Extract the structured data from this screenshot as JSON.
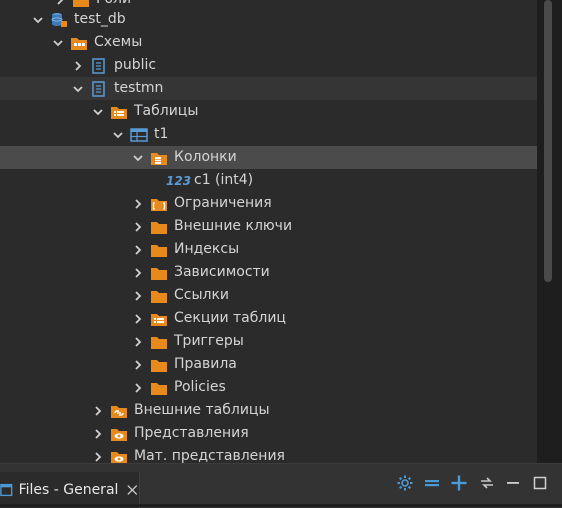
{
  "tree": {
    "items": [
      {
        "id": "roles",
        "label": "Роли",
        "twisty": "right",
        "icon": "folder-roles-icon"
      },
      {
        "id": "test_db",
        "label": "test_db",
        "twisty": "down",
        "icon": "database-icon"
      },
      {
        "id": "schemas",
        "label": "Схемы",
        "twisty": "down",
        "icon": "folder-schemas-icon"
      },
      {
        "id": "public",
        "label": "public",
        "twisty": "right",
        "icon": "schema-icon"
      },
      {
        "id": "testmn",
        "label": "testmn",
        "twisty": "down",
        "icon": "schema-icon"
      },
      {
        "id": "tables",
        "label": "Таблицы",
        "twisty": "down",
        "icon": "folder-tables-icon"
      },
      {
        "id": "t1",
        "label": "t1",
        "twisty": "down",
        "icon": "table-icon"
      },
      {
        "id": "columns",
        "label": "Колонки",
        "twisty": "down",
        "icon": "folder-columns-icon"
      },
      {
        "id": "c1",
        "label": "c1 (int4)",
        "twisty": "none",
        "icon": "numeric-column-icon",
        "icon_text": "123"
      },
      {
        "id": "constraints",
        "label": "Ограничения",
        "twisty": "right",
        "icon": "folder-constraints-icon"
      },
      {
        "id": "fk",
        "label": "Внешние ключи",
        "twisty": "right",
        "icon": "folder-icon"
      },
      {
        "id": "indexes",
        "label": "Индексы",
        "twisty": "right",
        "icon": "folder-icon"
      },
      {
        "id": "deps",
        "label": "Зависимости",
        "twisty": "right",
        "icon": "folder-icon"
      },
      {
        "id": "refs",
        "label": "Ссылки",
        "twisty": "right",
        "icon": "folder-icon"
      },
      {
        "id": "partitions",
        "label": "Секции таблиц",
        "twisty": "right",
        "icon": "folder-partitions-icon"
      },
      {
        "id": "triggers",
        "label": "Триггеры",
        "twisty": "right",
        "icon": "folder-icon"
      },
      {
        "id": "rules",
        "label": "Правила",
        "twisty": "right",
        "icon": "folder-icon"
      },
      {
        "id": "policies",
        "label": "Policies",
        "twisty": "right",
        "icon": "folder-icon"
      },
      {
        "id": "foreign_tables",
        "label": "Внешние таблицы",
        "twisty": "right",
        "icon": "folder-foreign-tables-icon"
      },
      {
        "id": "views",
        "label": "Представления",
        "twisty": "right",
        "icon": "folder-views-icon"
      },
      {
        "id": "mat_views",
        "label": "Мат. представления",
        "twisty": "right",
        "icon": "folder-views-icon"
      }
    ]
  },
  "bottom_panel": {
    "tab_label": "Files - General",
    "toolbar": [
      "settings-icon",
      "collapse-icon",
      "add-icon",
      "sync-icon",
      "minimize-icon",
      "maximize-icon"
    ]
  },
  "colors": {
    "folder": "#e8891c",
    "accent": "#4a9ad8",
    "background": "#2b2b2b",
    "selection": "#4b4b4b"
  }
}
